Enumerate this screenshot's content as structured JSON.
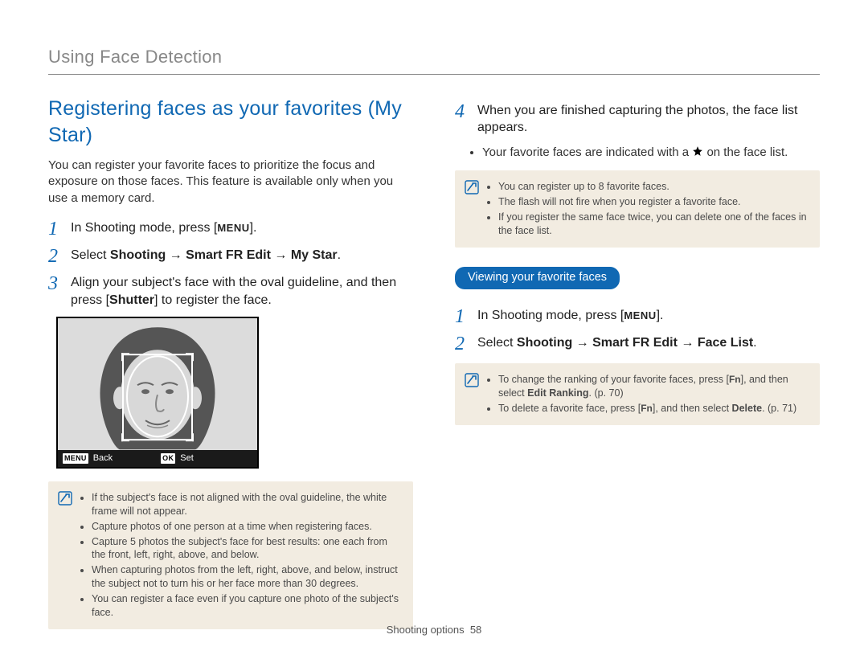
{
  "header": {
    "title": "Using Face Detection"
  },
  "left": {
    "section_title": "Registering faces as your favorites (My Star)",
    "intro": "You can register your favorite faces to prioritize the focus and exposure on those faces. This feature is available only when you use a memory card.",
    "step1_a": "In Shooting mode, press [",
    "step1_menu": "MENU",
    "step1_b": "].",
    "step2_a": "Select ",
    "step2_b1": "Shooting",
    "step2_arrow": " → ",
    "step2_b2": "Smart FR Edit",
    "step2_b3": "My Star",
    "step2_end": ".",
    "step3_a": "Align your subject's face with the oval guideline, and then press [",
    "step3_shutter": "Shutter",
    "step3_b": "] to register the face.",
    "figure": {
      "back_btn": "MENU",
      "back_label": "Back",
      "ok_btn": "OK",
      "set_label": "Set"
    },
    "callout": {
      "items": [
        "If the subject's face is not aligned with the oval guideline, the white frame will not appear.",
        "Capture photos of one person at a time when registering faces.",
        "Capture 5 photos the subject's face for best results: one each from the front, left, right, above, and below.",
        "When capturing photos from the left, right, above, and below, instruct the subject not to turn his or her face more than 30 degrees.",
        "You can register a face even if you capture one photo of the subject's face."
      ]
    }
  },
  "right": {
    "step4_a": "When you are finished capturing the photos, the face list appears.",
    "step4_sub_a": "Your favorite faces are indicated with a ",
    "step4_sub_b": " on the face list.",
    "callout1": {
      "items": [
        "You can register up to 8 favorite faces.",
        "The flash will not fire when you register a favorite face.",
        "If you register the same face twice, you can delete one of the faces in the face list."
      ]
    },
    "pill": "Viewing your favorite faces",
    "step1_a": "In Shooting mode, press [",
    "step1_menu": "MENU",
    "step1_b": "].",
    "step2_a": "Select ",
    "step2_b1": "Shooting",
    "step2_arrow": " → ",
    "step2_b2": "Smart FR Edit",
    "step2_b3": "Face List",
    "step2_end": ".",
    "callout2": {
      "item1_a": "To change the ranking of your favorite faces, press [",
      "item1_fn": "Fn",
      "item1_b": "], and then select ",
      "item1_bold": "Edit Ranking",
      "item1_c": ". (p. 70)",
      "item2_a": "To delete a favorite face, press [",
      "item2_fn": "Fn",
      "item2_b": "], and then select ",
      "item2_bold": "Delete",
      "item2_c": ". (p. 71)"
    }
  },
  "footer": {
    "section": "Shooting options",
    "page": "58"
  }
}
